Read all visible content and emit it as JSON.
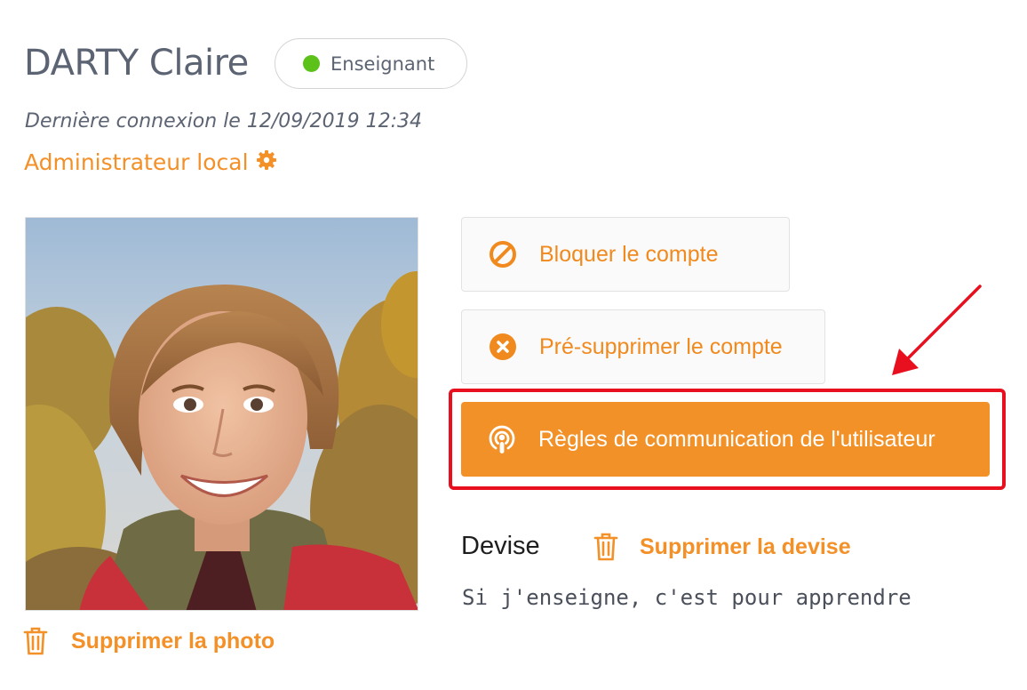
{
  "user": {
    "name": "DARTY Claire",
    "role": "Enseignant",
    "role_color": "#5cc21a",
    "last_login": "Dernière connexion le 12/09/2019 12:34",
    "admin_label": "Administrateur local"
  },
  "photo": {
    "delete_label": "Supprimer la photo"
  },
  "actions": {
    "block_label": "Bloquer le compte",
    "predelete_label": "Pré-supprimer le compte",
    "rules_label": "Règles de communication de l'utilisateur"
  },
  "motto": {
    "label": "Devise",
    "delete_label": "Supprimer la devise",
    "text": "Si j'enseigne, c'est pour apprendre"
  },
  "colors": {
    "accent": "#f29127",
    "highlight": "#e8101e",
    "text": "#5c6473"
  },
  "icons": [
    "gear-icon",
    "ban-icon",
    "x-circle-icon",
    "podcast-icon",
    "trash-icon",
    "arrow-icon"
  ]
}
